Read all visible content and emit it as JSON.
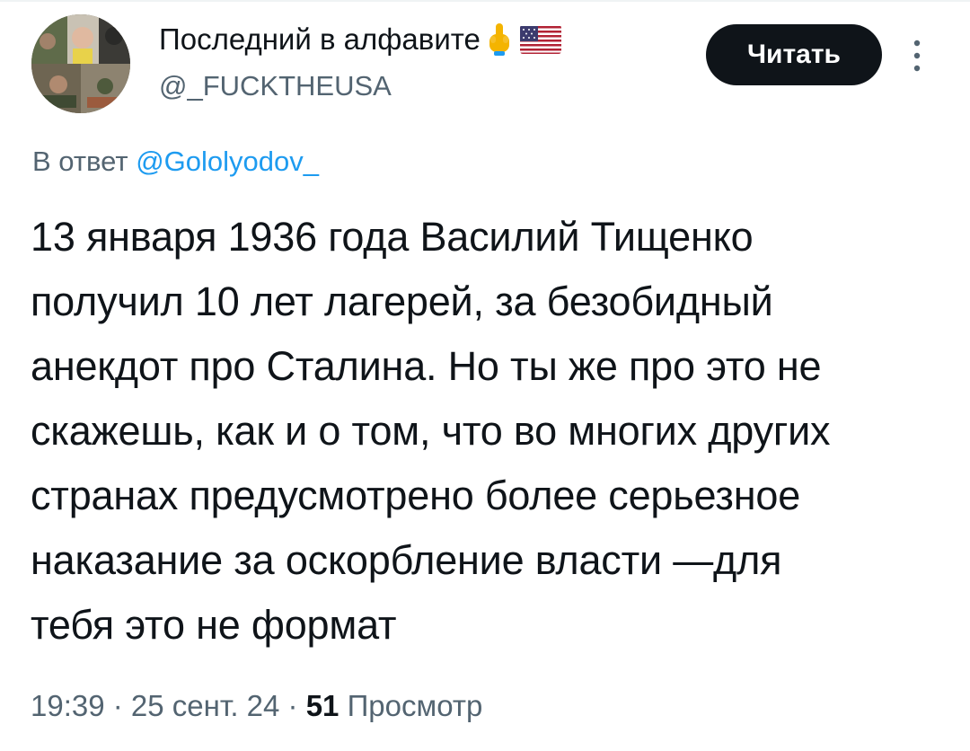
{
  "author": {
    "display_name": "Последний в алфавите",
    "handle": "@_FUCKTHEUSA",
    "emoji_icons": [
      "middle-finger-icon",
      "us-flag-icon"
    ]
  },
  "follow_button": {
    "label": "Читать"
  },
  "reply": {
    "prefix": "В ответ ",
    "mention": "@Gololyodov_"
  },
  "tweet": {
    "lines": [
      "13 января 1936 года Василий Тищенко",
      "получил 10 лет лагерей, за безобидный",
      "анекдот про Сталина. Но ты же про это не",
      "скажешь, как и о том, что во многих других",
      "странах предусмотрено более серьезное",
      "наказание за оскорбление власти —для",
      "тебя это не формат"
    ]
  },
  "meta": {
    "time": "19:39",
    "separator1": " · ",
    "date": "25 сент. 24",
    "separator2": " · ",
    "views_count": "51",
    "views_label": " Просмотр"
  },
  "colors": {
    "text": "#0f1419",
    "secondary": "#536471",
    "link": "#1d9bf0",
    "button_bg": "#0f1419"
  }
}
